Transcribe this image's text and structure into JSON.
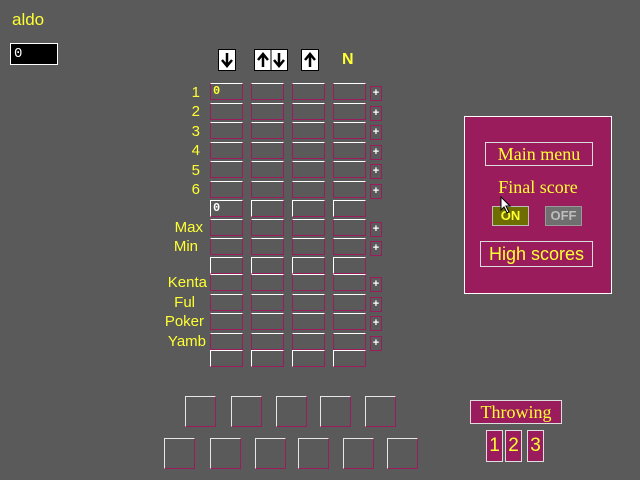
{
  "player": {
    "name": "aldo",
    "score": "0"
  },
  "columns": {
    "n_label": "N",
    "icons": [
      "down-arrow-icon",
      "up-down-arrow-icon",
      "up-arrow-icon"
    ]
  },
  "rows": {
    "upper": [
      "1",
      "2",
      "3",
      "4",
      "5",
      "6"
    ],
    "middle": [
      "Max",
      "Min"
    ],
    "lower": [
      "Kenta",
      "Ful",
      "Poker",
      "Yamb"
    ]
  },
  "cells": {
    "down_row1": "0",
    "upper_sum_down": "0"
  },
  "plus_label": "+",
  "panel": {
    "main_menu": "Main menu",
    "final_score": "Final score",
    "on": "ON",
    "off": "OFF",
    "high_scores": "High scores"
  },
  "throwing": {
    "label": "Throwing",
    "buttons": [
      "1",
      "2",
      "3"
    ]
  },
  "colors": {
    "background": "#5a5a5a",
    "accent": "#9a1c5c",
    "text": "#ffff33"
  }
}
